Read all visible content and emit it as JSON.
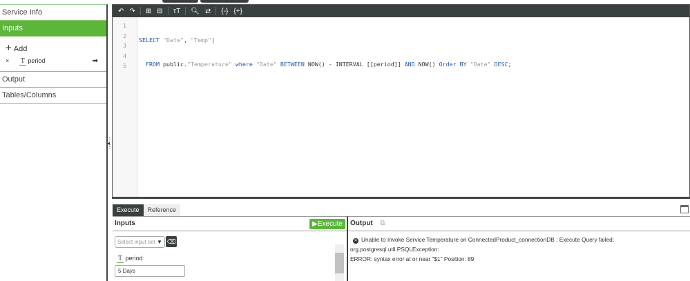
{
  "sidebar": {
    "items": [
      {
        "label": "Service Info"
      },
      {
        "label": "Inputs"
      },
      {
        "label": "Output"
      },
      {
        "label": "Tables/Columns"
      }
    ],
    "add_label": "Add",
    "param_name": "period",
    "param_type_glyph": "T"
  },
  "toolbar": {
    "icons": [
      "undo-icon",
      "redo-icon",
      "comment-icon",
      "uncomment-icon",
      "format-icon",
      "search-icon",
      "replace-icon",
      "collapse-icon",
      "expand-icon"
    ]
  },
  "editor": {
    "line_numbers": [
      "1",
      "2",
      "3",
      "4",
      "5"
    ]
  },
  "bottom": {
    "tabs": [
      "Execute",
      "Reference"
    ],
    "inputs_title": "Inputs",
    "execute_label": "Execute",
    "select_placeholder": "Select input set",
    "param_label": "period",
    "param_value": "5 Days",
    "output_title": "Output",
    "error_line1": "Unable to Invoke Service Temperature on ConnectedProduct_connectionDB : Execute Query failed: org.postgresql.util.PSQLException:",
    "error_line2": "ERROR: syntax error at or near \"$1\" Position: 89"
  },
  "colors": {
    "accent": "#5bb63a",
    "toolbar": "#3a4040"
  }
}
